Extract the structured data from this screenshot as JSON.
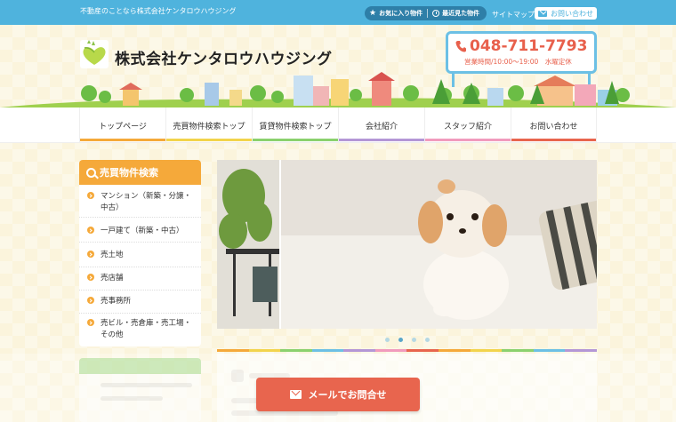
{
  "header": {
    "tagline": "不動産のことなら株式会社ケンタロウハウジング",
    "favorites_label": "お気に入り物件",
    "recent_label": "最近見た物件",
    "sitemap_label": "サイトマップ",
    "contact_label": "お問い合わせ",
    "company_name": "株式会社ケンタロウハウジング",
    "phone": "048-711-7793",
    "hours": "営業時間/10:00～19:00　水曜定休"
  },
  "nav": {
    "items": [
      {
        "label": "トップページ",
        "color": "#f5a93a"
      },
      {
        "label": "売買物件検索トップ",
        "color": "#f2d44c"
      },
      {
        "label": "賃貸物件検索トップ",
        "color": "#8bd16e"
      },
      {
        "label": "会社紹介",
        "color": "#b497d6"
      },
      {
        "label": "スタッフ紹介",
        "color": "#f19bbd"
      },
      {
        "label": "お問い合わせ",
        "color": "#e8654e"
      }
    ]
  },
  "sidebar": {
    "title": "売買物件検索",
    "items": [
      {
        "label": "マンション（新築・分譲・中古）"
      },
      {
        "label": "一戸建て（新築・中古）"
      },
      {
        "label": "売土地"
      },
      {
        "label": "売店舗"
      },
      {
        "label": "売事務所"
      },
      {
        "label": "売ビル・売倉庫・売工場・その他"
      }
    ]
  },
  "slider": {
    "active_index": 1,
    "count": 4
  },
  "cta": {
    "mail_label": "メールでお問合せ"
  },
  "colors": {
    "topbar": "#4fb3dd",
    "accent_orange": "#f5a93a",
    "accent_red": "#e8654e"
  }
}
